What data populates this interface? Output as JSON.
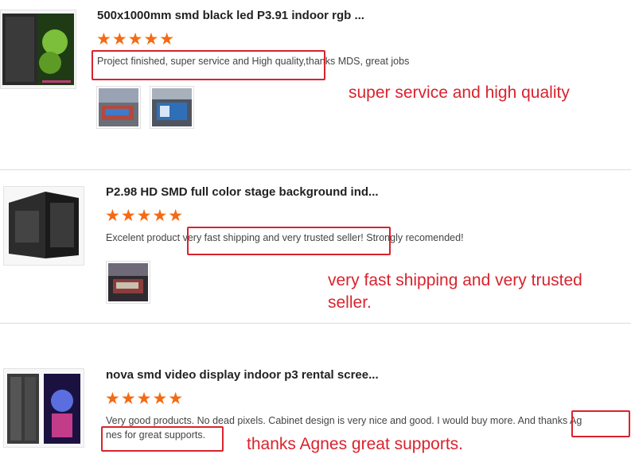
{
  "reviews": [
    {
      "title": "500x1000mm smd black led P3.91 indoor rgb ...",
      "stars": "★★★★★",
      "comment": "Project finished, super service and High quality,thanks MDS, great jobs",
      "note": "super service and high quality"
    },
    {
      "title": "P2.98 HD SMD full color stage background ind...",
      "stars": "★★★★★",
      "comment": "Excelent product very fast shipping and very trusted seller! Strongly recomended!",
      "note_line1": "very fast shipping and very trusted",
      "note_line2": "seller."
    },
    {
      "title": "nova smd video display indoor p3 rental scree...",
      "stars": "★★★★★",
      "comment_line1": "Very good products. No dead pixels. Cabinet design is very nice and good. I would buy more. And thanks Ag",
      "comment_line2": "nes for great supports.",
      "note": "thanks Agnes great supports."
    }
  ],
  "colors": {
    "star": "#f56a12",
    "highlight": "#d9232d"
  }
}
